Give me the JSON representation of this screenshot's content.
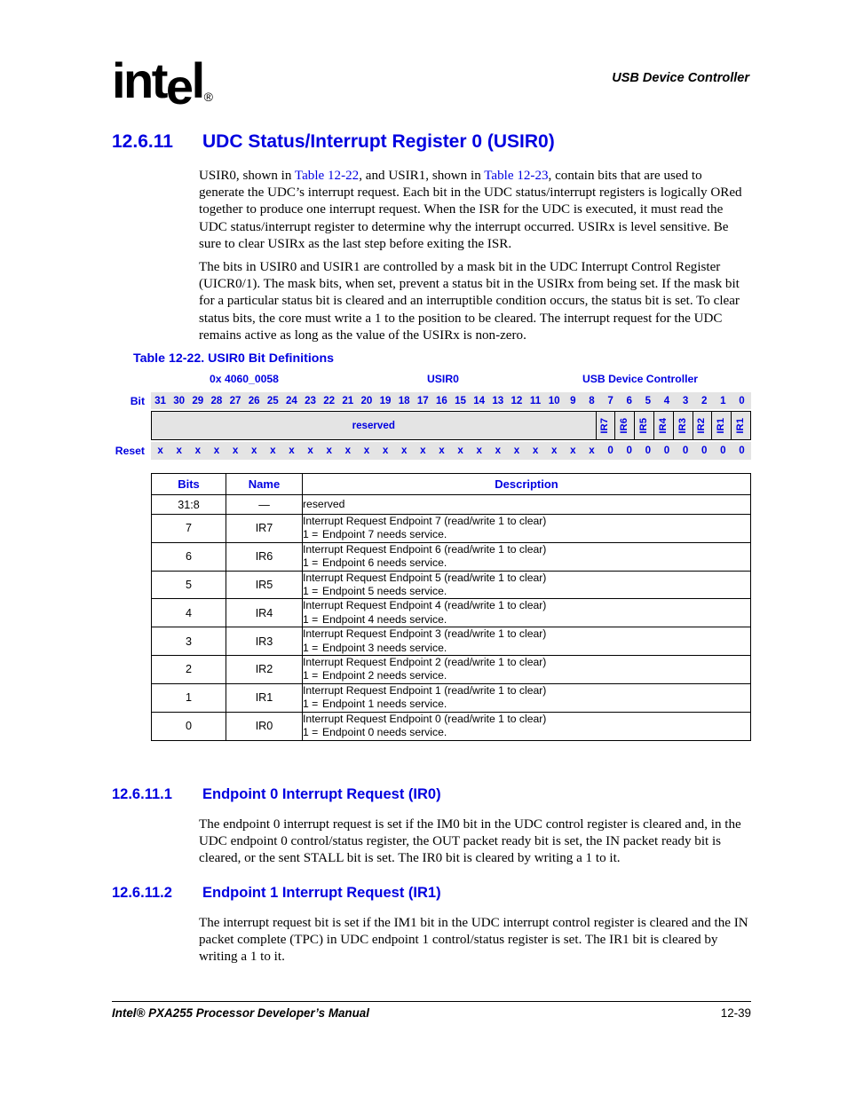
{
  "header": {
    "logo_text": "intel",
    "logo_registered": "®",
    "running_head": "USB Device Controller"
  },
  "section": {
    "number": "12.6.11",
    "title": "UDC Status/Interrupt Register 0 (USIR0)",
    "paragraph1_parts": {
      "a": "USIR0, shown in ",
      "xref1": "Table 12-22",
      "b": ", and USIR1, shown in ",
      "xref2": "Table 12-23",
      "c": ", contain bits that are used to generate the UDC’s interrupt request. Each bit in the UDC status/interrupt registers is logically ORed together to produce one interrupt request. When the ISR for the UDC is executed, it must read the UDC status/interrupt register to determine why the interrupt occurred. USIRx is level sensitive. Be sure to clear USIRx as the last step before exiting the ISR."
    },
    "paragraph2": "The bits in USIR0 and USIR1 are controlled by a mask bit in the UDC Interrupt Control Register (UICR0/1). The mask bits, when set, prevent a status bit in the USIRx from being set. If the mask bit for a particular status bit is cleared and an interruptible condition occurs, the status bit is set. To clear status bits, the core must write a 1 to the position to be cleared. The interrupt request for the UDC remains active as long as the value of the USIRx is non-zero."
  },
  "table": {
    "caption": "Table 12-22. USIR0 Bit Definitions",
    "register": {
      "address": "0x 4060_0058",
      "name": "USIR0",
      "owner": "USB Device Controller",
      "bit_label": "Bit",
      "reset_label": "Reset",
      "bit_numbers": [
        "31",
        "30",
        "29",
        "28",
        "27",
        "26",
        "25",
        "24",
        "23",
        "22",
        "21",
        "20",
        "19",
        "18",
        "17",
        "16",
        "15",
        "14",
        "13",
        "12",
        "11",
        "10",
        "9",
        "8",
        "7",
        "6",
        "5",
        "4",
        "3",
        "2",
        "1",
        "0"
      ],
      "reserved_label": "reserved",
      "field_labels": [
        "IR7",
        "IR6",
        "IR5",
        "IR4",
        "IR3",
        "IR2",
        "IR1",
        "IR1"
      ],
      "reset_values": [
        "x",
        "x",
        "x",
        "x",
        "x",
        "x",
        "x",
        "x",
        "x",
        "x",
        "x",
        "x",
        "x",
        "x",
        "x",
        "x",
        "x",
        "x",
        "x",
        "x",
        "x",
        "x",
        "x",
        "x",
        "0",
        "0",
        "0",
        "0",
        "0",
        "0",
        "0",
        "0"
      ]
    },
    "columns": [
      "Bits",
      "Name",
      "Description"
    ],
    "rows": [
      {
        "bits": "31:8",
        "name": "—",
        "desc_line1": "reserved",
        "desc_line2": ""
      },
      {
        "bits": "7",
        "name": "IR7",
        "desc_line1": "Interrupt Request Endpoint 7 (read/write 1 to clear)",
        "desc_line2_eq": "1 =",
        "desc_line2": "Endpoint 7 needs service."
      },
      {
        "bits": "6",
        "name": "IR6",
        "desc_line1": "Interrupt Request Endpoint 6 (read/write 1 to clear)",
        "desc_line2_eq": "1 =",
        "desc_line2": "Endpoint 6 needs service."
      },
      {
        "bits": "5",
        "name": "IR5",
        "desc_line1": "Interrupt Request Endpoint 5 (read/write 1 to clear)",
        "desc_line2_eq": "1 =",
        "desc_line2": "Endpoint 5 needs service."
      },
      {
        "bits": "4",
        "name": "IR4",
        "desc_line1": "Interrupt Request Endpoint 4 (read/write 1 to clear)",
        "desc_line2_eq": "1 =",
        "desc_line2": "Endpoint 4 needs service."
      },
      {
        "bits": "3",
        "name": "IR3",
        "desc_line1": "Interrupt Request Endpoint 3 (read/write 1 to clear)",
        "desc_line2_eq": "1 =",
        "desc_line2": "Endpoint 3 needs service."
      },
      {
        "bits": "2",
        "name": "IR2",
        "desc_line1": "Interrupt Request Endpoint 2 (read/write 1 to clear)",
        "desc_line2_eq": "1 =",
        "desc_line2": "Endpoint 2 needs service."
      },
      {
        "bits": "1",
        "name": "IR1",
        "desc_line1": "Interrupt Request Endpoint 1 (read/write 1 to clear)",
        "desc_line2_eq": "1 =",
        "desc_line2": "Endpoint 1 needs service."
      },
      {
        "bits": "0",
        "name": "IR0",
        "desc_line1": "Interrupt Request Endpoint 0 (read/write 1 to clear)",
        "desc_line2_eq": "1 =",
        "desc_line2": "Endpoint 0 needs service."
      }
    ]
  },
  "subsection1": {
    "number": "12.6.11.1",
    "title": "Endpoint 0 Interrupt Request (IR0)",
    "paragraph": "The endpoint 0 interrupt request is set if the IM0 bit in the UDC control register is cleared and, in the UDC endpoint 0 control/status register, the OUT packet ready bit is set, the IN packet ready bit is cleared, or the sent STALL bit is set. The IR0 bit is cleared by writing a 1 to it."
  },
  "subsection2": {
    "number": "12.6.11.2",
    "title": "Endpoint 1 Interrupt Request (IR1)",
    "paragraph": "The interrupt request bit is set if the IM1 bit in the UDC interrupt control register is cleared and the IN packet complete (TPC) in UDC endpoint 1 control/status register is set. The IR1 bit is cleared by writing a 1 to it."
  },
  "footer": {
    "left": "Intel® PXA255 Processor Developer’s Manual",
    "right": "12-39"
  },
  "colors": {
    "accent_blue": "#0000e0",
    "register_band": "#e4e4e4"
  }
}
